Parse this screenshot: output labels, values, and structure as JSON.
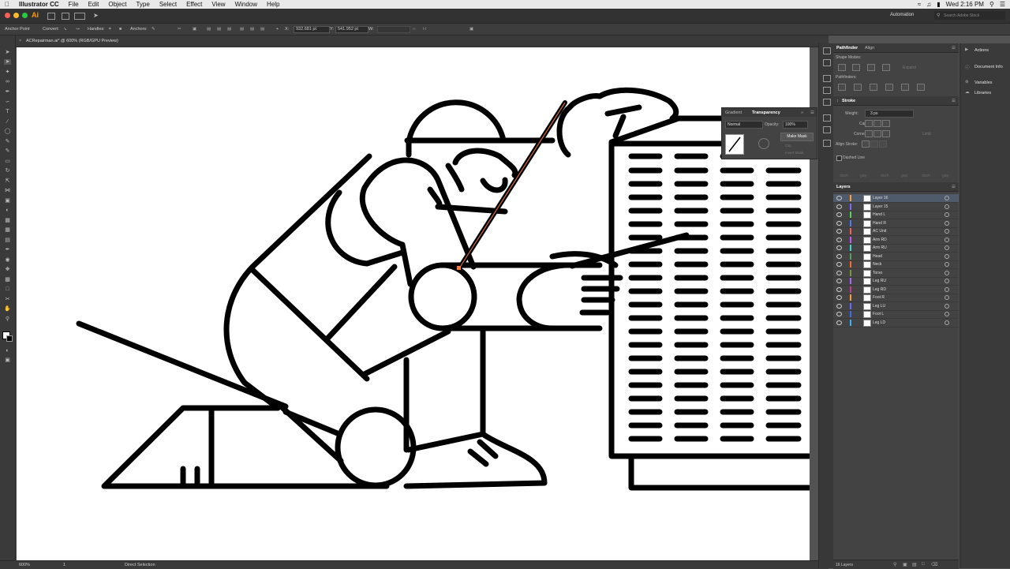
{
  "menubar": {
    "apple": "",
    "app": "Illustrator CC",
    "items": [
      "File",
      "Edit",
      "Object",
      "Type",
      "Select",
      "Effect",
      "View",
      "Window",
      "Help"
    ],
    "clock": "Wed 2:16 PM"
  },
  "appbar": {
    "logo": "Ai",
    "workspace": "Automation",
    "search_placeholder": "Search Adobe Stock"
  },
  "control": {
    "anchor_point": "Anchor Point",
    "convert": "Convert:",
    "handles": "Handles:",
    "anchors": "Anchors:",
    "x_label": "X:",
    "x_value": "932.681 pt",
    "y_label": "Y:",
    "y_value": "541.952 pt",
    "w_label": "W:"
  },
  "doc": {
    "tab_title": "ACRepairman.ai* @ 600% (RGB/GPU Preview)"
  },
  "status": {
    "zoom": "600%",
    "artboard": "1",
    "tool": "Direct Selection"
  },
  "pathfinder": {
    "tab1": "Pathfinder",
    "tab2": "Align",
    "shape_modes": "Shape Modes:",
    "expand": "Expand",
    "pathfinders": "Pathfinders:"
  },
  "stroke": {
    "title": "Stroke",
    "weight_label": "Weight:",
    "weight_value": "3 px",
    "cap_label": "Cap:",
    "corner_label": "Corner:",
    "limit_label": "Limit:",
    "align_label": "Align Stroke:",
    "dashed": "Dashed Line",
    "dash_labels": [
      "dash",
      "gap",
      "dash",
      "gap",
      "dash",
      "gap"
    ]
  },
  "transparency": {
    "tab1": "Gradient",
    "tab2": "Transparency",
    "mode": "Normal",
    "opacity_label": "Opacity:",
    "opacity_value": "100%",
    "make_mask": "Make Mask",
    "clip": "Clip",
    "invert": "Invert Mask"
  },
  "layers": {
    "title": "Layers",
    "count": "16 Layers",
    "rows": [
      {
        "name": "Layer 16",
        "color": "#ff9c3a",
        "selected": true
      },
      {
        "name": "Layer 15",
        "color": "#7a6cff"
      },
      {
        "name": "Hand L",
        "color": "#5ad25a"
      },
      {
        "name": "Hand R",
        "color": "#4c7bff"
      },
      {
        "name": "AC Unit",
        "color": "#ff5a5a"
      },
      {
        "name": "Arm RD",
        "color": "#cc55ff"
      },
      {
        "name": "Arm RU",
        "color": "#3ad6d6"
      },
      {
        "name": "Head",
        "color": "#5aa05a"
      },
      {
        "name": "Neck",
        "color": "#ff6a2a"
      },
      {
        "name": "Torso",
        "color": "#7a9a3a"
      },
      {
        "name": "Leg RU",
        "color": "#aa66ff"
      },
      {
        "name": "Leg RD",
        "color": "#cc3a99"
      },
      {
        "name": "Foot R",
        "color": "#ff9a3a"
      },
      {
        "name": "Leg LU",
        "color": "#6a6aff"
      },
      {
        "name": "Foot L",
        "color": "#3a6aff"
      },
      {
        "name": "Leg LD",
        "color": "#3ab0ff"
      }
    ]
  },
  "right_dock": {
    "actions": "Actions",
    "docinfo": "Document Info",
    "variables": "Variables",
    "libraries": "Libraries"
  },
  "colors": {
    "ui_dark": "#3a3a3a",
    "ui_panel": "#434343",
    "selection": "#ff7b3a",
    "menubar": "#e9e9e9"
  }
}
